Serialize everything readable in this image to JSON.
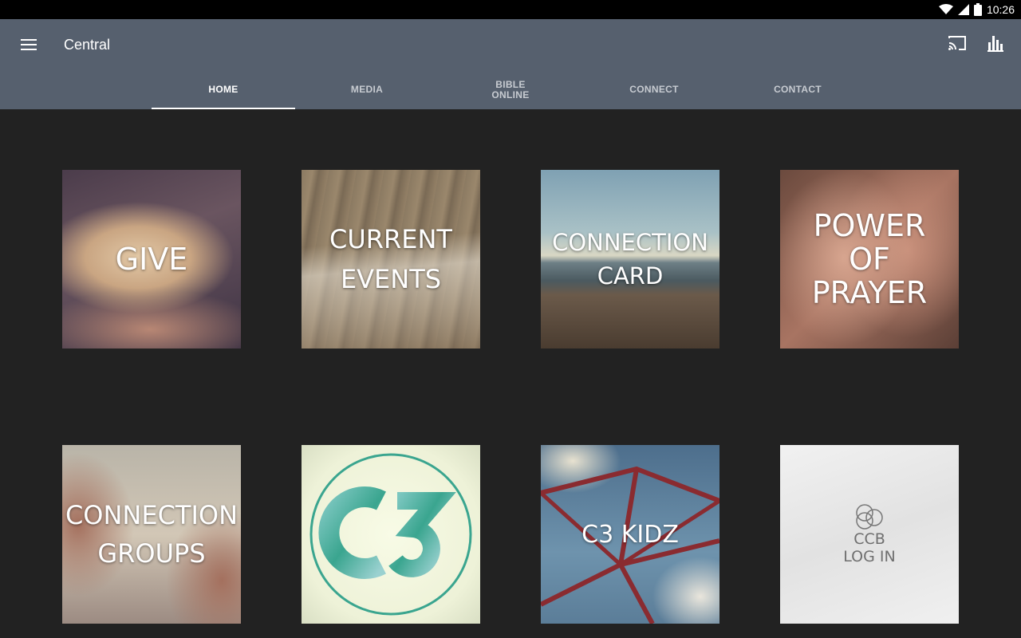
{
  "status_bar": {
    "time": "10:26",
    "icons": [
      "wifi-icon",
      "signal-icon",
      "battery-icon"
    ]
  },
  "app_bar": {
    "title": "Central",
    "background_color": "#56606e",
    "icons": [
      "menu-icon",
      "cast-icon",
      "stats-icon"
    ]
  },
  "tabs": [
    {
      "label": "HOME",
      "active": true
    },
    {
      "label": "MEDIA",
      "active": false
    },
    {
      "label": "BIBLE\nONLINE",
      "active": false
    },
    {
      "label": "CONNECT",
      "active": false
    },
    {
      "label": "CONTACT",
      "active": false
    }
  ],
  "tiles": [
    {
      "label": "GIVE"
    },
    {
      "label": "CURRENT\nEVENTS"
    },
    {
      "label": "CONNECTION\nCARD"
    },
    {
      "label": "POWER\nOF\nPRAYER"
    },
    {
      "label": "CONNECTION\nGROUPS"
    },
    {
      "label": "C3",
      "logo": true
    },
    {
      "label": "C3 KIDZ"
    },
    {
      "label": "CCB\nLOG IN"
    }
  ],
  "colors": {
    "background": "#222222",
    "status_bar": "#000000",
    "tab_active": "#ffffff",
    "tab_inactive": "#c7cbd1"
  }
}
